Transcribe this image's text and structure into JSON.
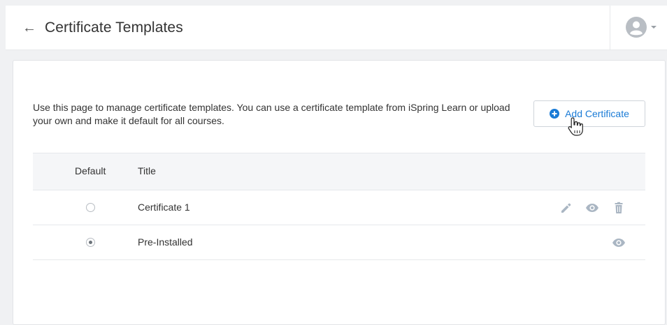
{
  "header": {
    "back_glyph": "←",
    "title": "Certificate Templates",
    "avatar_icon": "user-avatar-icon"
  },
  "main": {
    "description": "Use this page to manage certificate templates. You can use a certificate template from iSpring Learn or upload your own and make it default for all courses.",
    "add_button_label": "Add Certificate",
    "table": {
      "headers": {
        "default": "Default",
        "title": "Title"
      },
      "rows": [
        {
          "title": "Certificate 1",
          "default": false,
          "actions": [
            "edit",
            "preview",
            "delete"
          ]
        },
        {
          "title": "Pre-Installed",
          "default": true,
          "actions": [
            "preview"
          ]
        }
      ]
    }
  },
  "colors": {
    "accent": "#1a7bd6",
    "icon_muted": "#aab6c3",
    "header_bg": "#ffffff",
    "page_bg": "#f0f1f3"
  }
}
